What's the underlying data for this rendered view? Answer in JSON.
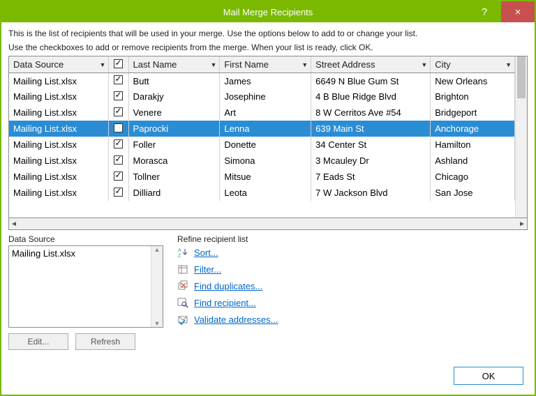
{
  "window": {
    "title": "Mail Merge Recipients",
    "help": "?",
    "close": "×"
  },
  "instructions": {
    "line1": "This is the list of recipients that will be used in your merge.  Use the options below to add to or change your list.",
    "line2": "Use the checkboxes to add or remove recipients from the merge.  When your list is ready, click OK."
  },
  "columns": {
    "data_source": "Data Source",
    "last_name": "Last Name",
    "first_name": "First Name",
    "street": "Street Address",
    "city": "City"
  },
  "rows": [
    {
      "ds": "Mailing List.xlsx",
      "checked": true,
      "sel": false,
      "ln": "Butt",
      "fn": "James",
      "sa": "6649 N Blue Gum St",
      "city": "New Orleans"
    },
    {
      "ds": "Mailing List.xlsx",
      "checked": true,
      "sel": false,
      "ln": "Darakjy",
      "fn": "Josephine",
      "sa": "4 B Blue Ridge Blvd",
      "city": "Brighton"
    },
    {
      "ds": "Mailing List.xlsx",
      "checked": true,
      "sel": false,
      "ln": "Venere",
      "fn": "Art",
      "sa": "8 W Cerritos Ave #54",
      "city": "Bridgeport"
    },
    {
      "ds": "Mailing List.xlsx",
      "checked": false,
      "sel": true,
      "ln": "Paprocki",
      "fn": "Lenna",
      "sa": "639 Main St",
      "city": "Anchorage"
    },
    {
      "ds": "Mailing List.xlsx",
      "checked": true,
      "sel": false,
      "ln": "Foller",
      "fn": "Donette",
      "sa": "34 Center St",
      "city": "Hamilton"
    },
    {
      "ds": "Mailing List.xlsx",
      "checked": true,
      "sel": false,
      "ln": "Morasca",
      "fn": "Simona",
      "sa": "3 Mcauley Dr",
      "city": "Ashland"
    },
    {
      "ds": "Mailing List.xlsx",
      "checked": true,
      "sel": false,
      "ln": "Tollner",
      "fn": "Mitsue",
      "sa": "7 Eads St",
      "city": "Chicago"
    },
    {
      "ds": "Mailing List.xlsx",
      "checked": true,
      "sel": false,
      "ln": "Dilliard",
      "fn": "Leota",
      "sa": "7 W Jackson Blvd",
      "city": "San Jose"
    }
  ],
  "data_source_panel": {
    "label": "Data Source",
    "items": [
      "Mailing List.xlsx"
    ],
    "edit": "Edit...",
    "refresh": "Refresh"
  },
  "refine": {
    "label": "Refine recipient list",
    "sort": "Sort...",
    "filter": "Filter...",
    "dupes": "Find duplicates...",
    "find": "Find recipient...",
    "validate": "Validate addresses..."
  },
  "footer": {
    "ok": "OK"
  }
}
